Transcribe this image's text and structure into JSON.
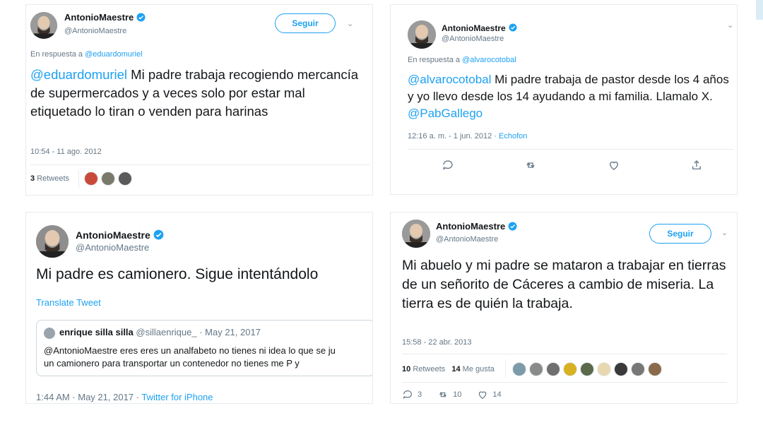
{
  "tweets": [
    {
      "name": "AntonioMaestre",
      "handle": "@AntonioMaestre",
      "follow_label": "Seguir",
      "reply_prefix": "En respuesta a ",
      "reply_to": "@eduardomuriel",
      "mention": "@eduardomuriel",
      "text": " Mi padre trabaja recogiendo mercancía de supermercados y a veces solo por estar mal etiquetado lo tiran o venden para harinas",
      "timestamp": "10:54 - 11 ago. 2012",
      "retweet_count": "3",
      "retweet_label": "Retweets",
      "liker_colors": [
        "#c94a3a",
        "#7a7a6a",
        "#5a5a5a"
      ]
    },
    {
      "name": "AntonioMaestre",
      "handle": "@AntonioMaestre",
      "reply_prefix": "En respuesta a ",
      "reply_to": "@alvarocotobal",
      "mention": "@alvarocotobal",
      "text": " Mi padre trabaja de pastor desde los 4 años y yo llevo desde los 14 ayudando a mi familia. Llamalo X. ",
      "mention_end": "@PabGallego",
      "timestamp": "12:16 a. m. - 1 jun. 2012",
      "source_sep": " · ",
      "source": "Echofon"
    },
    {
      "name": "AntonioMaestre",
      "handle": "@AntonioMaestre",
      "text": "Mi padre es camionero. Sigue intentándolo",
      "translate": "Translate Tweet",
      "quote": {
        "name": "enrique silla silla",
        "handle": "@sillaenrique_ · May 21, 2017",
        "line1": "@AntonioMaestre eres eres un analfabeto no tienes ni idea lo que se ju",
        "line2": "un camionero para transportar un contenedor no tienes me P y"
      },
      "timestamp": "1:44 AM · May 21, 2017",
      "source_sep": " · ",
      "source": "Twitter for iPhone"
    },
    {
      "name": "AntonioMaestre",
      "handle": "@AntonioMaestre",
      "follow_label": "Seguir",
      "text": "Mi abuelo y mi padre se mataron a trabajar en tierras de un señorito de Cáceres a cambio de miseria. La tierra es de quién la trabaja.",
      "timestamp": "15:58 - 22 abr. 2013",
      "retweet_count": "10",
      "retweet_label": "Retweets",
      "like_count": "14",
      "like_label": "Me gusta",
      "liker_colors": [
        "#7d9aa8",
        "#8a8a8a",
        "#6f6f6f",
        "#d8b120",
        "#5a6a4a",
        "#e8d8b0",
        "#3a3a3a",
        "#777777",
        "#8a6a4a"
      ],
      "reply_count": "3",
      "retweet_action_count": "10",
      "like_action_count": "14"
    }
  ],
  "colors": {
    "accent": "#1da1f2",
    "muted": "#657786",
    "border": "#e6ecf0"
  }
}
